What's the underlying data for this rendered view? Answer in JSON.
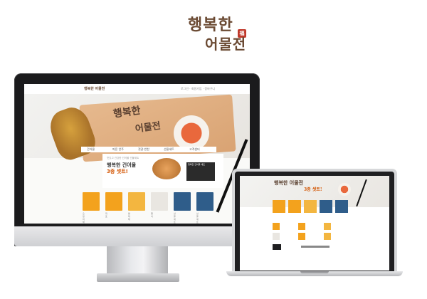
{
  "brand": {
    "line1": "행복한",
    "line2": "어물전",
    "seal": "福"
  },
  "desktop_site": {
    "nav_logo": "행복한 어물전",
    "nav_links": "로그인 · 회원가입 · 장바구니",
    "hero_title_line1": "행복한",
    "hero_title_line2": "어물전",
    "menu": [
      "건어물",
      "마른 안주",
      "젓갈·반찬",
      "선물세트",
      "고객센터"
    ],
    "promo": {
      "small": "맛있고 건강한 건어물 선물세트",
      "title_line1": "행복한 건어물",
      "title_line2": "3종 셋트!",
      "box_text": "행복한 건어물 세트"
    },
    "products": [
      {
        "label": "오징어채",
        "color": "#f3a21d"
      },
      {
        "label": "쥐포",
        "color": "#f3a21d"
      },
      {
        "label": "황태채",
        "color": "#f3b640"
      },
      {
        "label": "멸치",
        "color": "#e9e6e1"
      },
      {
        "label": "선물세트",
        "color": "#2f5d8a"
      },
      {
        "label": "선물세트",
        "color": "#2f5d8a"
      }
    ]
  },
  "laptop_site": {
    "hero_title": "행복한 어물전",
    "promo_title": "3종 셋트!"
  },
  "colors": {
    "brand_brown": "#6b4a33",
    "accent_orange": "#d35400",
    "device_dark": "#1b1b1d"
  }
}
